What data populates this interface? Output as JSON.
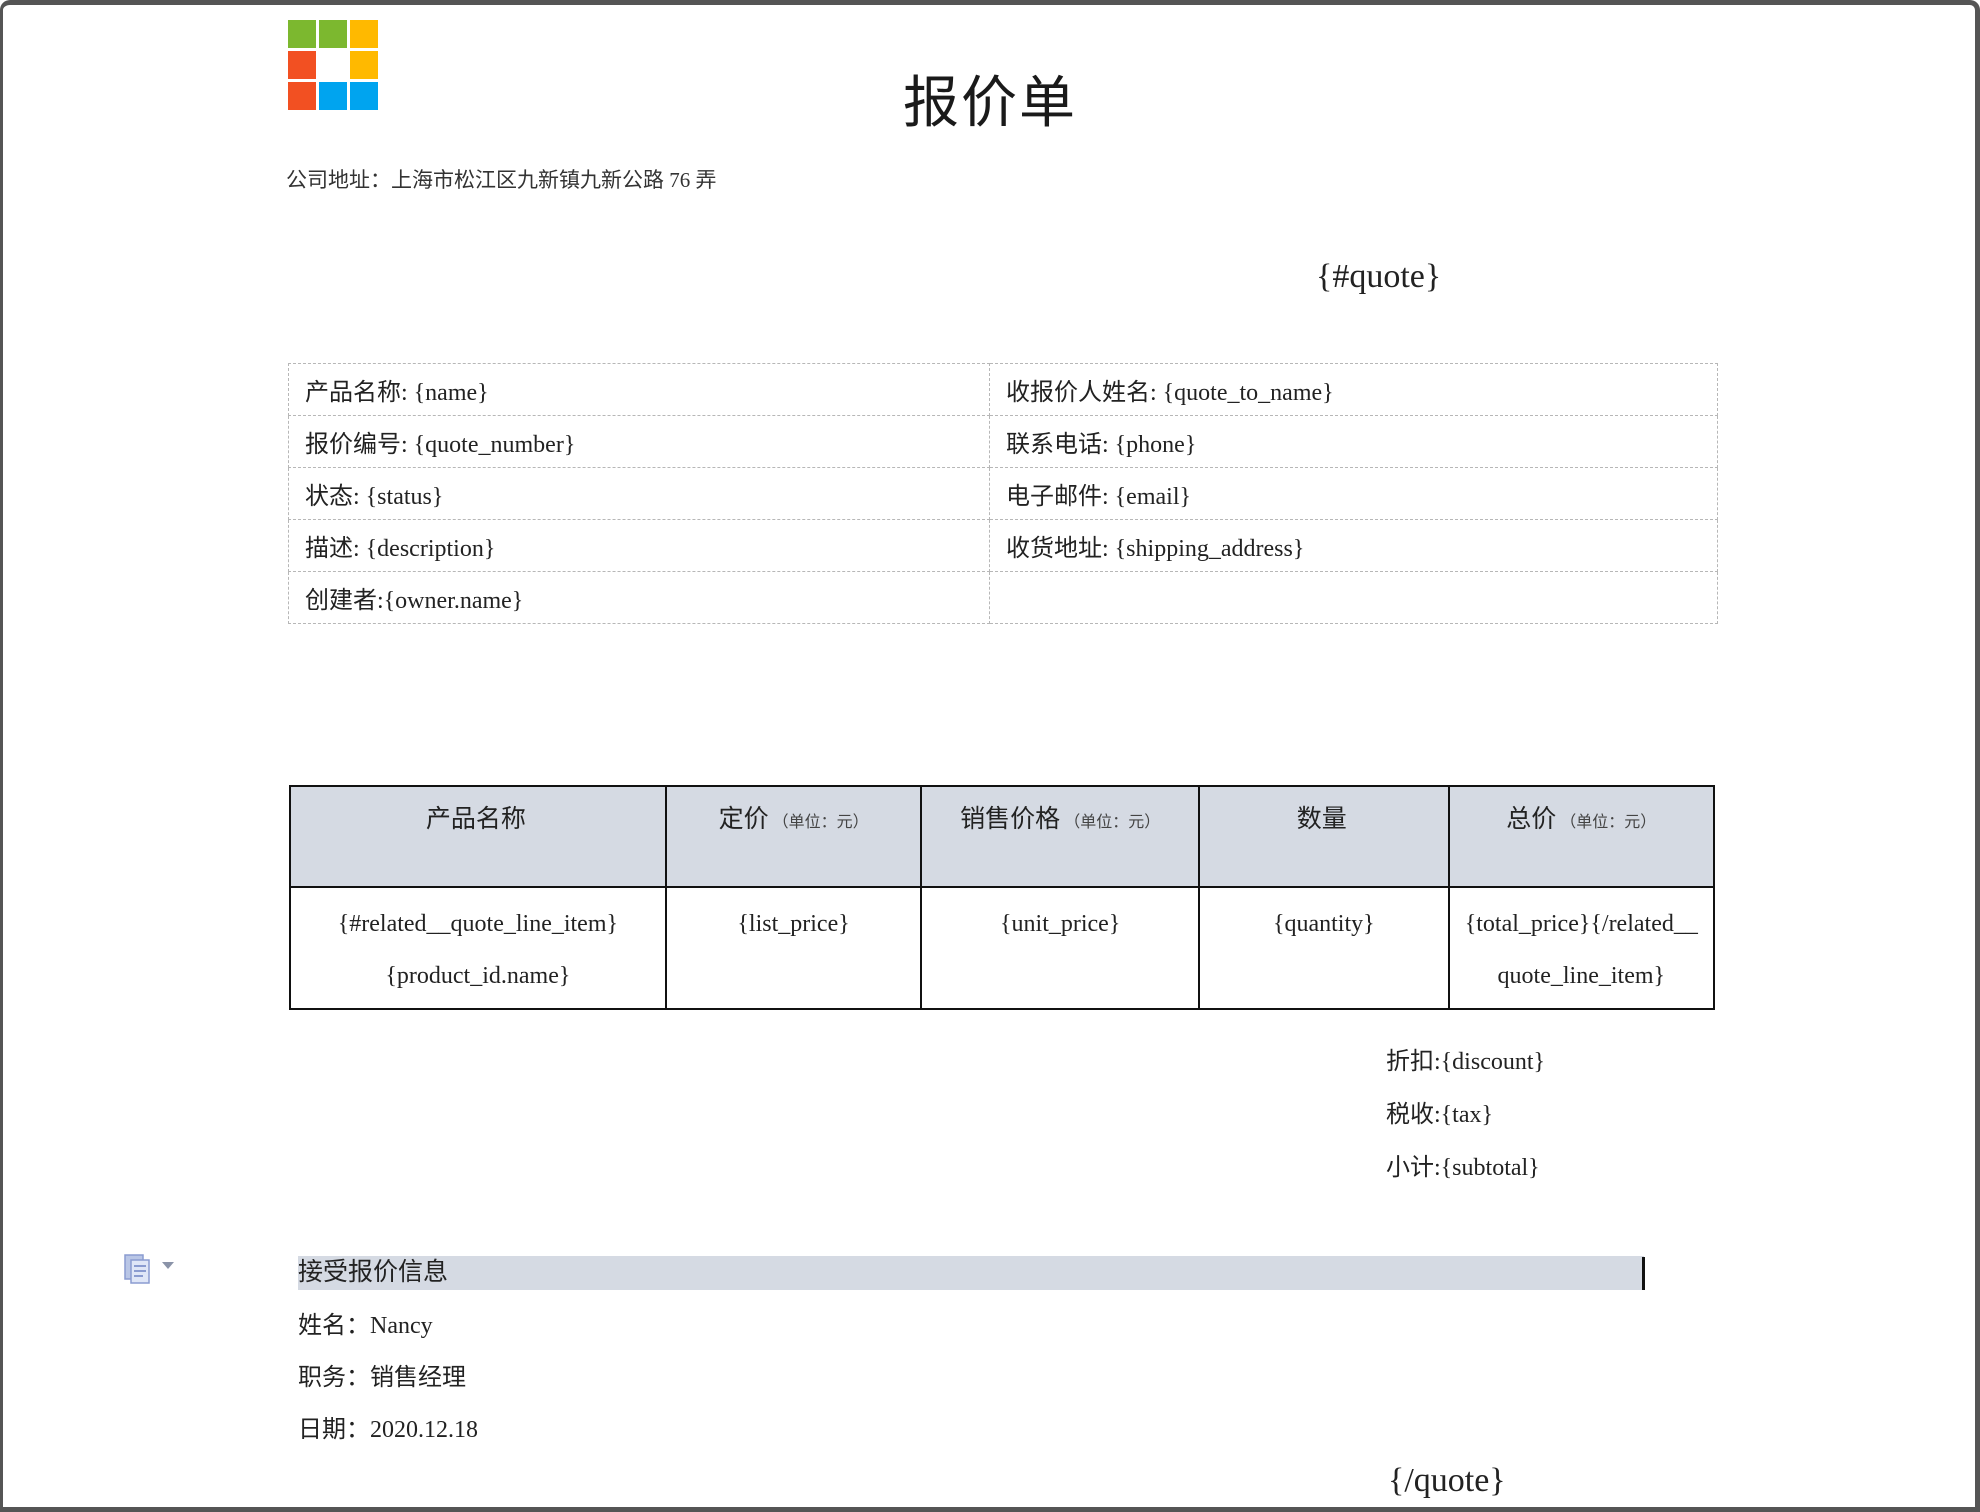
{
  "document": {
    "title": "报价单",
    "company_address": "公司地址：上海市松江区九新镇九新公路 76 弄",
    "quote_open_tag": "{#quote}",
    "quote_close_tag": "{/quote}",
    "logo_colors": [
      "#7cb82f",
      "#7cb82f",
      "#ffb900",
      "#f25022",
      "",
      "#ffb900",
      "#f25022",
      "#00a4ef",
      "#00a4ef"
    ]
  },
  "info_table": {
    "rows": [
      [
        "产品名称: {name}",
        "收报价人姓名: {quote_to_name}"
      ],
      [
        "报价编号: {quote_number}",
        "联系电话: {phone}"
      ],
      [
        "状态: {status}",
        "电子邮件: {email}"
      ],
      [
        "描述: {description}",
        "收货地址: {shipping_address}"
      ],
      [
        "创建者:{owner.name}",
        ""
      ]
    ]
  },
  "items_table": {
    "headers": [
      {
        "label": "产品名称",
        "unit": ""
      },
      {
        "label": "定价",
        "unit": "（单位：元）"
      },
      {
        "label": "销售价格",
        "unit": "（单位：元）"
      },
      {
        "label": "数量",
        "unit": ""
      },
      {
        "label": "总价",
        "unit": "（单位：元）"
      }
    ],
    "row": [
      "{#related__quote_line_item}{product_id.name}",
      "{list_price}",
      "{unit_price}",
      "{quantity}",
      "{total_price}{/related__quote_line_item}"
    ]
  },
  "totals": {
    "discount": "折扣:{discount}",
    "tax": "税收:{tax}",
    "subtotal": "小计:{subtotal}"
  },
  "acceptance": {
    "heading": "接受报价信息",
    "name_line": "姓名：Nancy",
    "role_line": "职务：销售经理",
    "date_line": "日期：2020.12.18"
  },
  "colors": {
    "header_fill": "#d5dae3",
    "frame": "#555555"
  }
}
